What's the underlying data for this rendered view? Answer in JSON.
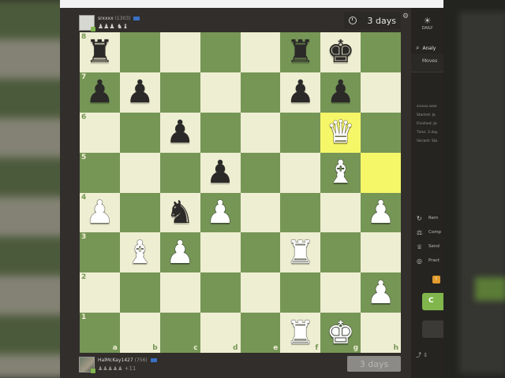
{
  "top_player": {
    "name": "srxxxx",
    "rating": "(1303)",
    "captured": "♟♟♟ ♞♝"
  },
  "top_clock": "3 days",
  "bottom_player": {
    "name": "HalMcKay1427",
    "rating": "(756)",
    "captured": "♟♟♟♟♟ +11"
  },
  "bottom_clock": "3 days",
  "board": {
    "ranks": [
      "8",
      "7",
      "6",
      "5",
      "4",
      "3",
      "2",
      "1"
    ],
    "files": [
      "a",
      "b",
      "c",
      "d",
      "e",
      "f",
      "g",
      "h"
    ],
    "position": [
      [
        "bR",
        "",
        "",
        "",
        "",
        "bR",
        "bK",
        ""
      ],
      [
        "bP",
        "bP",
        "",
        "",
        "",
        "bP",
        "bP",
        ""
      ],
      [
        "",
        "",
        "bP",
        "",
        "",
        "",
        "wQ",
        ""
      ],
      [
        "",
        "",
        "",
        "bP",
        "",
        "",
        "wB",
        ""
      ],
      [
        "wP",
        "",
        "bN",
        "wP",
        "",
        "",
        "",
        "wP"
      ],
      [
        "",
        "wB",
        "wP",
        "",
        "",
        "wR",
        "",
        ""
      ],
      [
        "",
        "",
        "",
        "",
        "",
        "",
        "",
        "wP"
      ],
      [
        "",
        "",
        "",
        "",
        "",
        "wR",
        "wK",
        ""
      ]
    ],
    "highlighted": [
      "g6",
      "h5"
    ]
  },
  "panel": {
    "daily_label": "DAILY",
    "analysis_label": "Analy",
    "moves_tab": "Moves",
    "info_lines": [
      "srxxxx woo",
      "Started: Ja",
      "Finished: Ja",
      "Time: 3 day",
      "Variant: Sta"
    ],
    "actions": [
      {
        "icon": "rematch-icon",
        "glyph": "↻",
        "label": "Rem"
      },
      {
        "icon": "compare-icon",
        "glyph": "⚖",
        "label": "Comp"
      },
      {
        "icon": "trophy-icon",
        "glyph": "♕",
        "label": "Send"
      },
      {
        "icon": "target-icon",
        "glyph": "◎",
        "label": "Pract"
      }
    ],
    "badge": "!",
    "green_button": "C"
  },
  "colors": {
    "light_square": "#eeeed2",
    "dark_square": "#769656",
    "highlight": "#f6f669",
    "accent_green": "#81b64c"
  }
}
